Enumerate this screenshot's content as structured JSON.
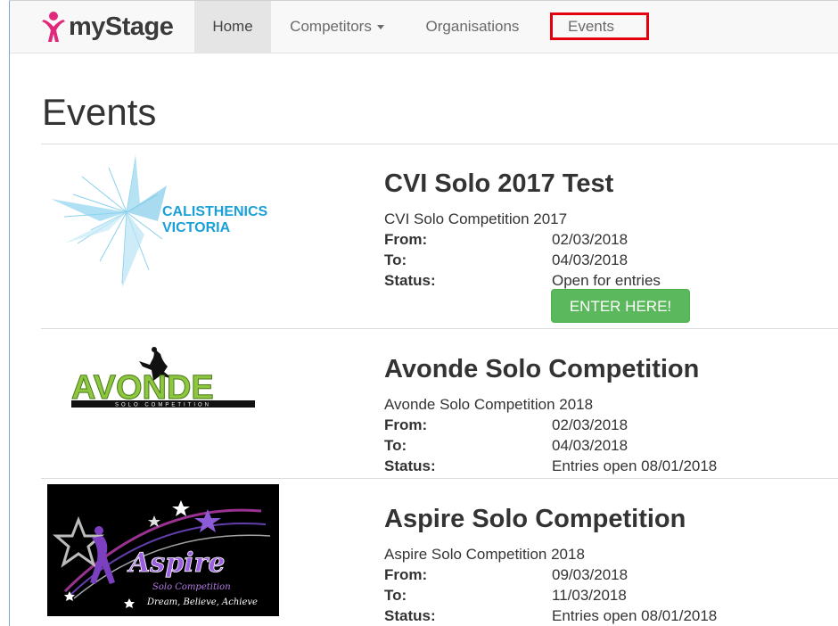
{
  "brand": {
    "name": "myStage"
  },
  "nav": {
    "home": "Home",
    "competitors": "Competitors",
    "organisations": "Organisations",
    "events": "Events"
  },
  "page": {
    "title": "Events"
  },
  "labels": {
    "from": "From:",
    "to": "To:",
    "status": "Status:"
  },
  "events": [
    {
      "title": "CVI Solo 2017 Test",
      "subtitle": "CVI Solo Competition 2017",
      "from": "02/03/2018",
      "to": "04/03/2018",
      "status": "Open for entries",
      "button": "ENTER HERE!",
      "logo_line1": "CALISTHENICS",
      "logo_line2": "VICTORIA"
    },
    {
      "title": "Avonde Solo Competition",
      "subtitle": "Avonde Solo Competition 2018",
      "from": "02/03/2018",
      "to": "04/03/2018",
      "status": "Entries open 08/01/2018",
      "logo_text": "AVONDE",
      "logo_sub": "SOLO COMPETITION"
    },
    {
      "title": "Aspire Solo Competition",
      "subtitle": "Aspire Solo Competition 2018",
      "from": "09/03/2018",
      "to": "11/03/2018",
      "status": "Entries open 08/01/2018",
      "logo_text": "Aspire",
      "logo_sub": "Solo Competition",
      "logo_tagline": "Dream, Believe, Achieve"
    }
  ]
}
